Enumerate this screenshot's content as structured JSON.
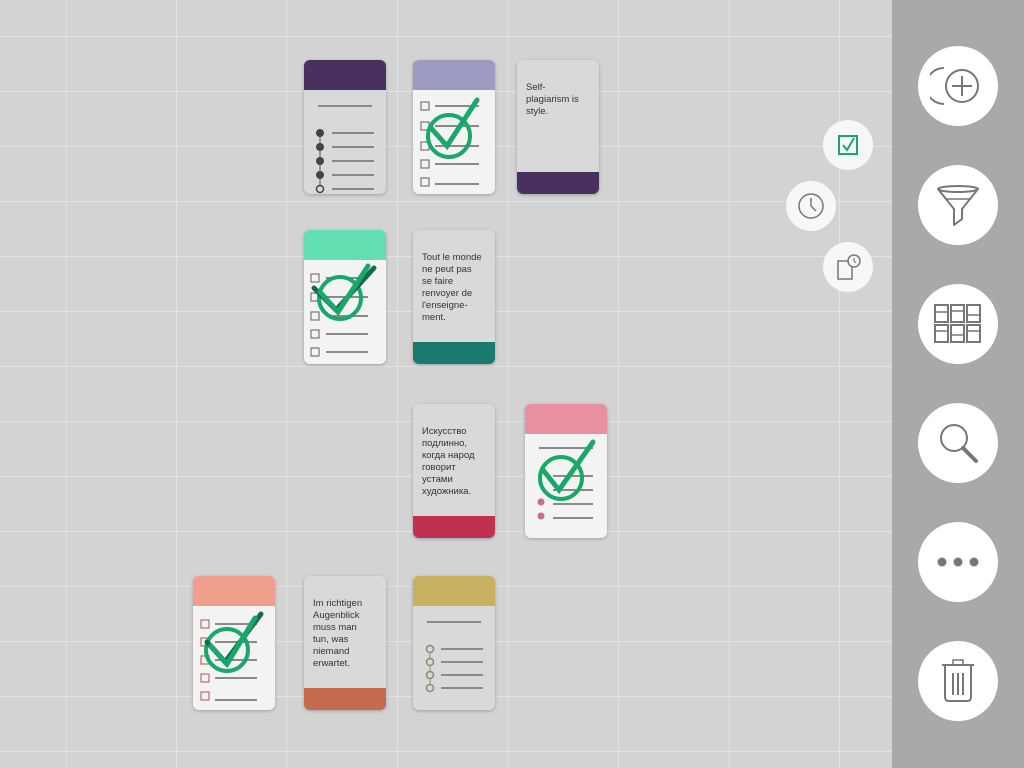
{
  "notes": {
    "self_plagiarism": "Self-\nplagiarism is\nstyle.",
    "tout_le_monde": "Tout le monde\nne peut pas\nse faire\nrenvoyer de\nl'enseigne-\nment.",
    "iskusstvo": "Искусство\nподлинно,\nкогда народ\nговорит\nустами\nхудожника.",
    "im_richtigen": "Im richtigen\nAugenblick\nmuss man\ntun, was\nniemand\nerwartet."
  },
  "colors": {
    "purple": "#4a3060",
    "lavender": "#9b9bc4",
    "mint": "#62e0b2",
    "teal": "#1a7a6e",
    "pink": "#e88fa0",
    "crimson": "#c0304f",
    "salmon": "#eea08c",
    "terracotta": "#c66a4f",
    "mustard": "#c9b060",
    "check_green": "#1aa86a"
  },
  "sidebar": {
    "buttons": [
      "add-card-icon",
      "filter-icon",
      "grid-view-icon",
      "search-icon",
      "more-icon",
      "trash-icon"
    ]
  },
  "mini_buttons": [
    "checklist-icon",
    "clock-icon",
    "timer-note-icon"
  ]
}
